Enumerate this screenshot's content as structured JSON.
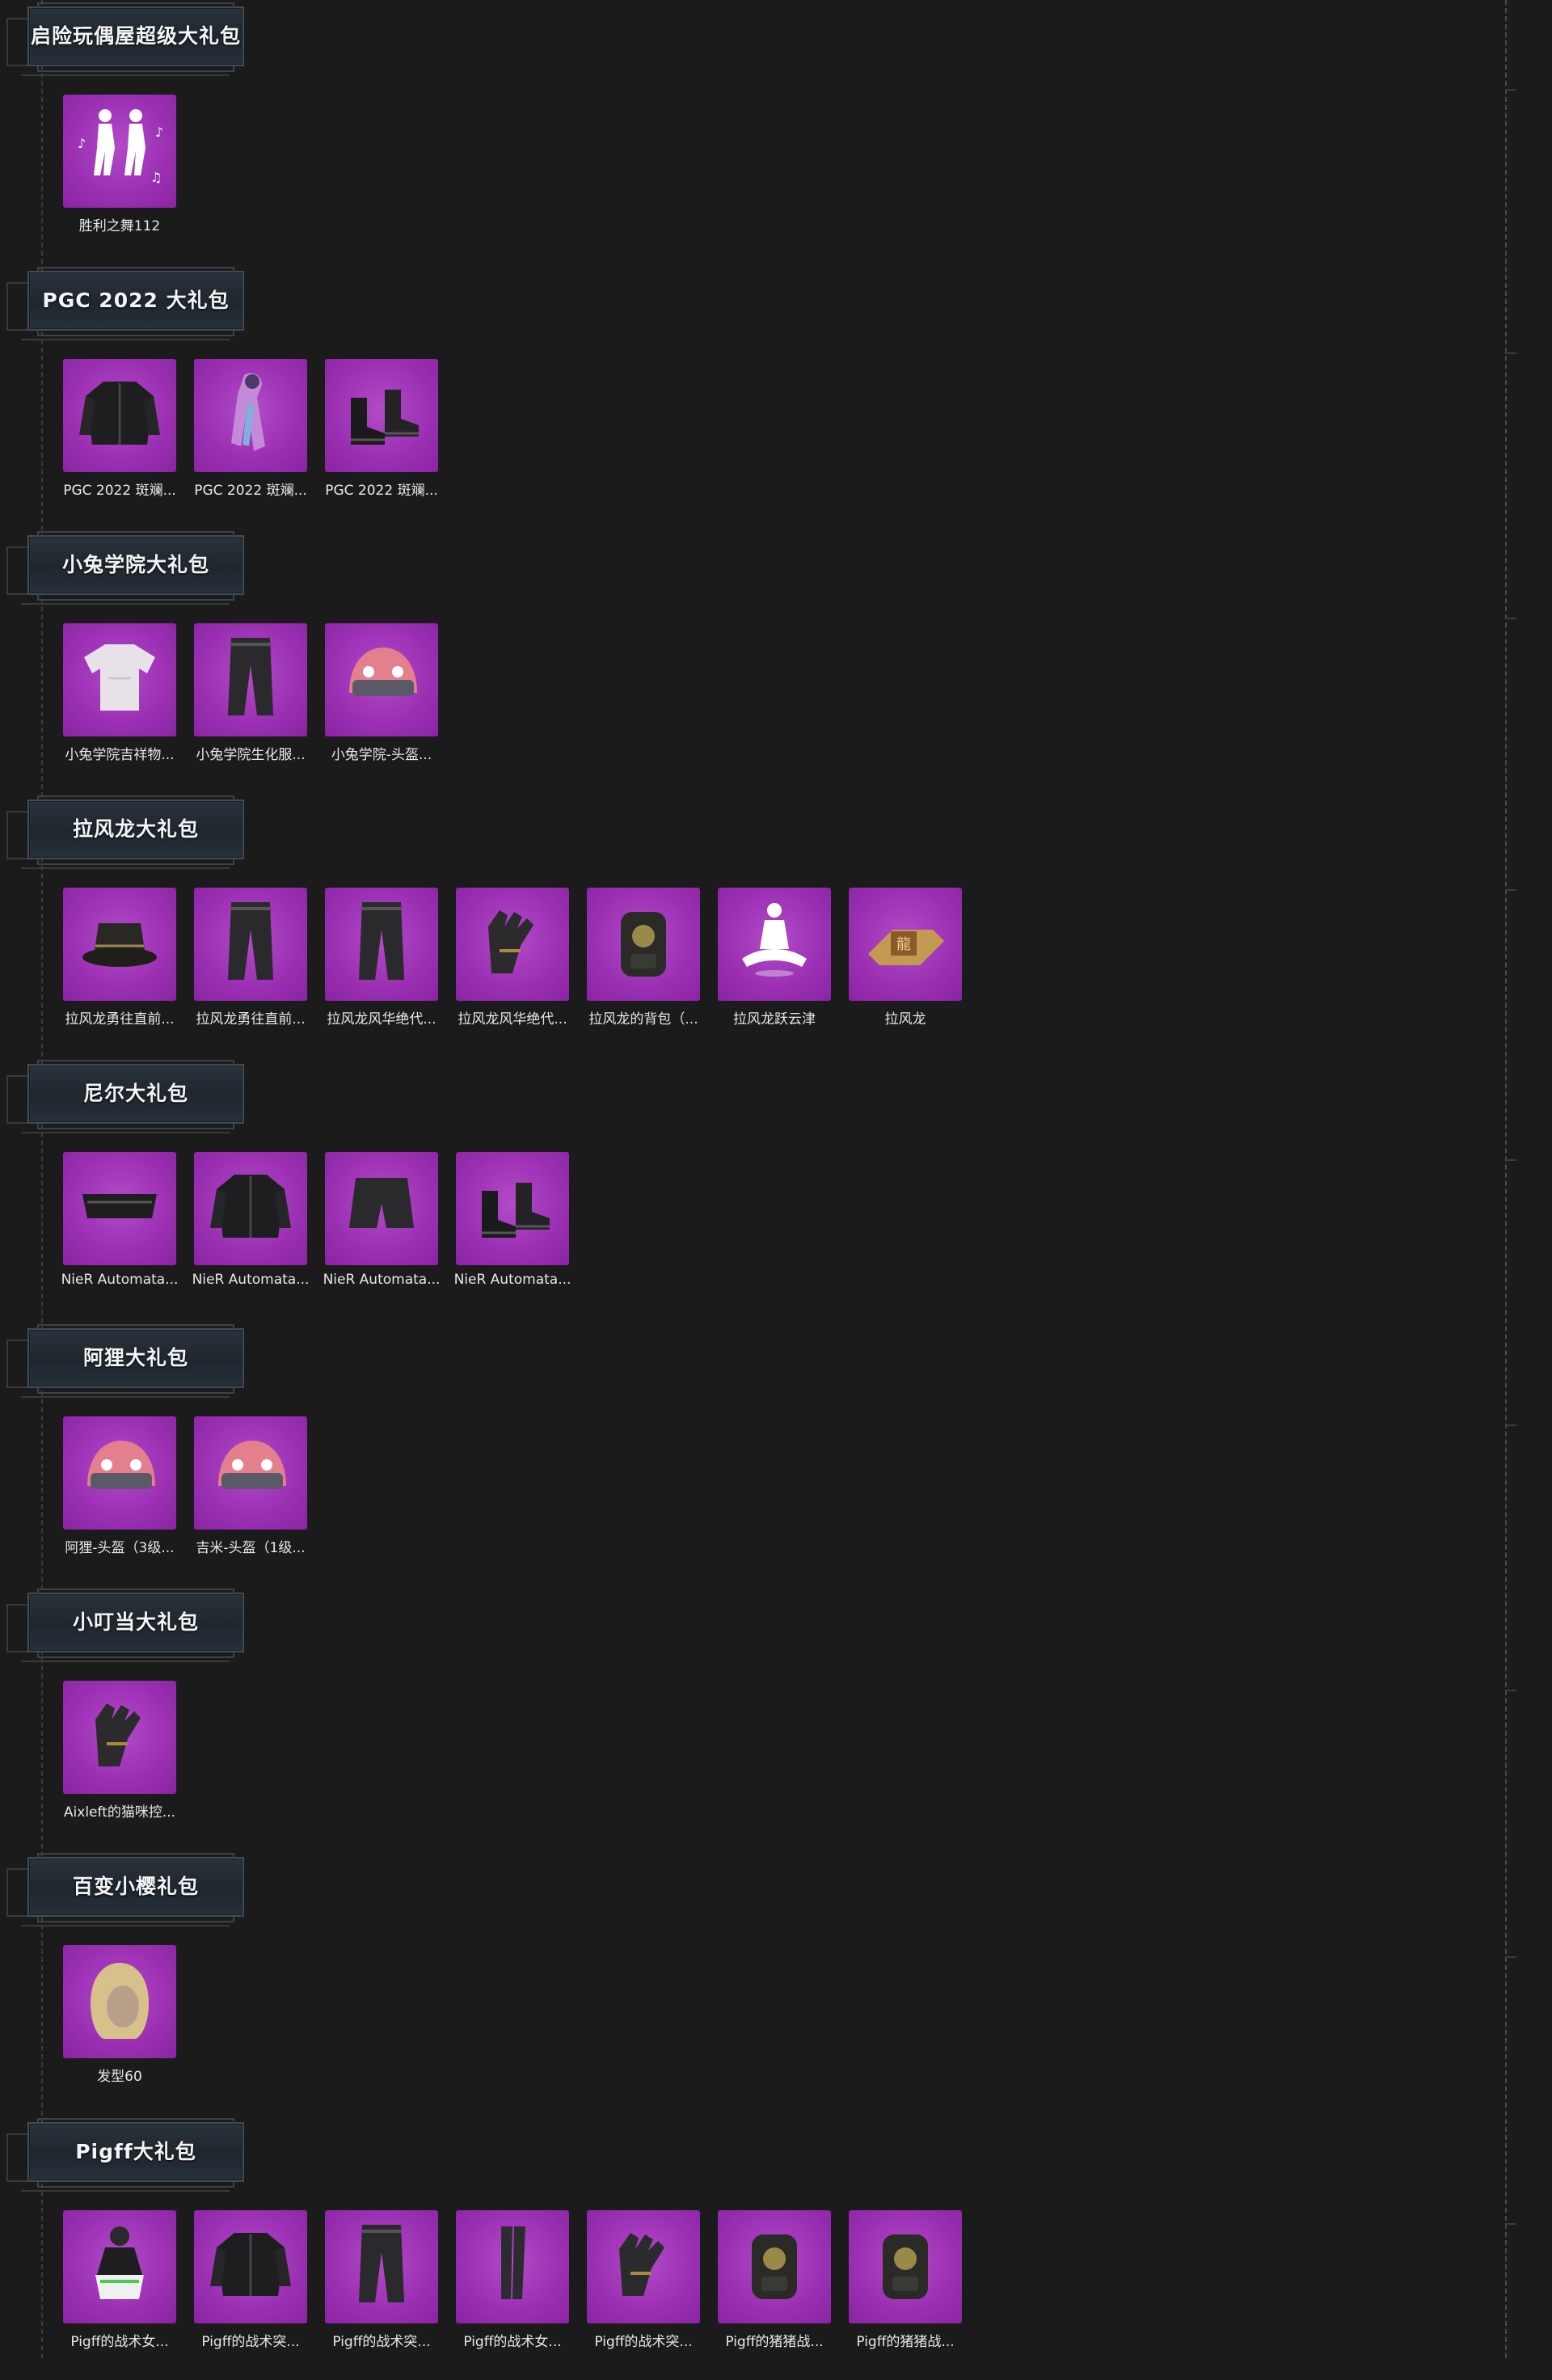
{
  "colors": {
    "background": "#1b1b1c",
    "tile": "#9a2fb2",
    "header_box": "#242b33",
    "text": "#ffffff"
  },
  "packages": [
    {
      "title": "启险玩偶屋超级大礼包",
      "items": [
        {
          "label": "胜利之舞112",
          "icon": "emote-dance-icon"
        }
      ]
    },
    {
      "title": "PGC 2022 大礼包",
      "items": [
        {
          "label": "PGC 2022 斑斓...",
          "icon": "jacket-icon"
        },
        {
          "label": "PGC 2022 斑斓...",
          "icon": "scarf-icon"
        },
        {
          "label": "PGC 2022 斑斓...",
          "icon": "boots-icon"
        }
      ]
    },
    {
      "title": "小兔学院大礼包",
      "items": [
        {
          "label": "小兔学院吉祥物...",
          "icon": "shirt-icon"
        },
        {
          "label": "小兔学院生化服...",
          "icon": "pants-icon"
        },
        {
          "label": "小兔学院-头盔...",
          "icon": "helmet-icon"
        }
      ]
    },
    {
      "title": "拉风龙大礼包",
      "items": [
        {
          "label": "拉风龙勇往直前...",
          "icon": "hat-icon"
        },
        {
          "label": "拉风龙勇往直前...",
          "icon": "pants-icon"
        },
        {
          "label": "拉风龙风华绝代...",
          "icon": "pants-icon"
        },
        {
          "label": "拉风龙风华绝代...",
          "icon": "gloves-icon"
        },
        {
          "label": "拉风龙的背包（...",
          "icon": "backpack-icon"
        },
        {
          "label": "拉风龙跃云津",
          "icon": "emote-meditate-icon"
        },
        {
          "label": "拉风龙",
          "icon": "dragon-emblem-icon"
        }
      ]
    },
    {
      "title": "尼尔大礼包",
      "items": [
        {
          "label": "NieR Automata...",
          "icon": "mask-icon"
        },
        {
          "label": "NieR Automata...",
          "icon": "jacket-icon"
        },
        {
          "label": "NieR Automata...",
          "icon": "shorts-icon"
        },
        {
          "label": "NieR Automata...",
          "icon": "boots-icon"
        }
      ]
    },
    {
      "title": "阿狸大礼包",
      "items": [
        {
          "label": "阿狸-头盔（3级...",
          "icon": "helmet-icon"
        },
        {
          "label": "吉米-头盔（1级...",
          "icon": "helmet-icon"
        }
      ]
    },
    {
      "title": "小叮当大礼包",
      "items": [
        {
          "label": "Aixleft的猫咪控...",
          "icon": "gloves-icon"
        }
      ]
    },
    {
      "title": "百变小樱礼包",
      "items": [
        {
          "label": "发型60",
          "icon": "hairstyle-icon"
        }
      ]
    },
    {
      "title": "Pigff大礼包",
      "items": [
        {
          "label": "Pigff的战术女...",
          "icon": "outfit-icon"
        },
        {
          "label": "Pigff的战术突...",
          "icon": "jacket-icon"
        },
        {
          "label": "Pigff的战术突...",
          "icon": "pants-icon"
        },
        {
          "label": "Pigff的战术女...",
          "icon": "stockings-icon"
        },
        {
          "label": "Pigff的战术突...",
          "icon": "gloves-icon"
        },
        {
          "label": "Pigff的猪猪战...",
          "icon": "backpack-icon"
        },
        {
          "label": "Pigff的猪猪战...",
          "icon": "backpack-icon"
        }
      ]
    }
  ]
}
